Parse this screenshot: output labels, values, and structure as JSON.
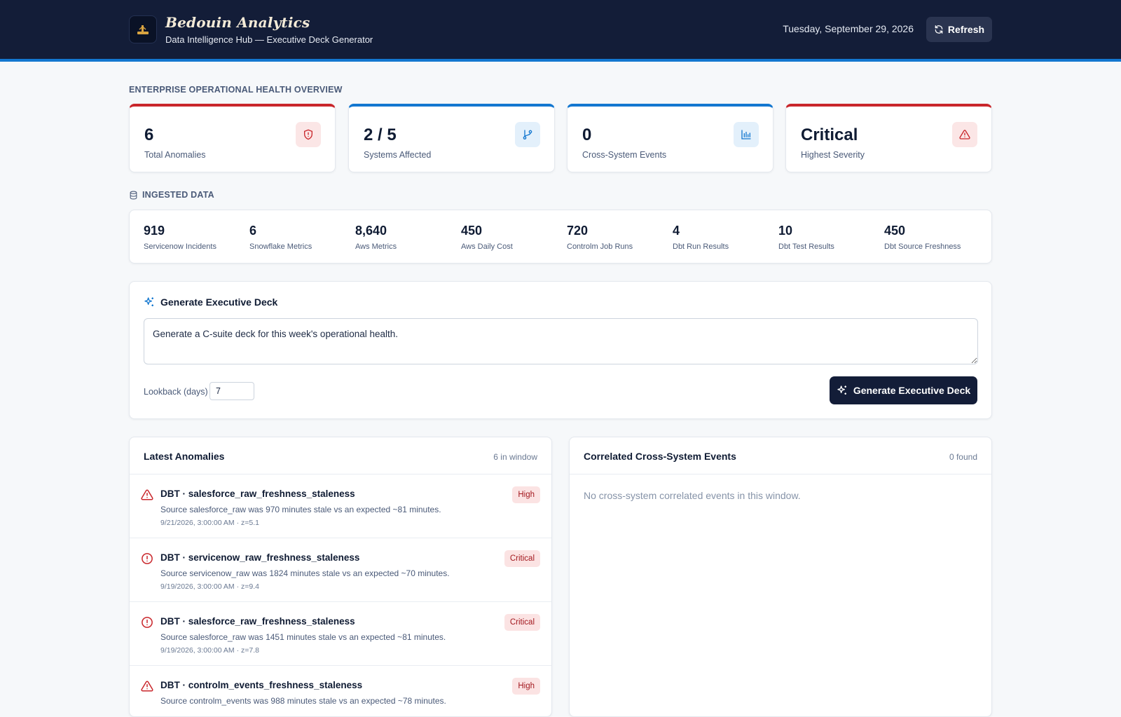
{
  "header": {
    "brand": "Bedouin Analytics",
    "subtitle": "Data Intelligence Hub — Executive Deck Generator",
    "date": "Tuesday, September 29, 2026",
    "refresh_label": "Refresh"
  },
  "overview": {
    "label": "ENTERPRISE OPERATIONAL HEALTH OVERVIEW",
    "cards": [
      {
        "value": "6",
        "label": "Total Anomalies",
        "icon": "shield-alert-icon",
        "accent": "#c9262b"
      },
      {
        "value": "2 / 5",
        "label": "Systems Affected",
        "icon": "git-branch-icon",
        "accent": "#1377d0"
      },
      {
        "value": "0",
        "label": "Cross-System Events",
        "icon": "bar-chart-icon",
        "accent": "#1377d0"
      },
      {
        "value": "Critical",
        "label": "Highest Severity",
        "icon": "warning-triangle-icon",
        "accent": "#c9262b"
      }
    ]
  },
  "ingested": {
    "label": "INGESTED DATA",
    "items": [
      {
        "value": "919",
        "label": "Servicenow Incidents"
      },
      {
        "value": "6",
        "label": "Snowflake Metrics"
      },
      {
        "value": "8,640",
        "label": "Aws Metrics"
      },
      {
        "value": "450",
        "label": "Aws Daily Cost"
      },
      {
        "value": "720",
        "label": "Controlm Job Runs"
      },
      {
        "value": "4",
        "label": "Dbt Run Results"
      },
      {
        "value": "10",
        "label": "Dbt Test Results"
      },
      {
        "value": "450",
        "label": "Dbt Source Freshness"
      }
    ]
  },
  "generate": {
    "title": "Generate Executive Deck",
    "prompt_value": "Generate a C-suite deck for this week's operational health.",
    "lookback_label": "Lookback (days)",
    "lookback_value": "7",
    "button_label": "Generate Executive Deck"
  },
  "anomalies": {
    "title": "Latest Anomalies",
    "count": "6 in window",
    "items": [
      {
        "title": "DBT · salesforce_raw_freshness_staleness",
        "desc": "Source salesforce_raw was 970 minutes stale vs an expected ~81 minutes.",
        "meta": "9/21/2026, 3:00:00 AM · z=5.1",
        "severity": "High",
        "icon": "warning-triangle-icon"
      },
      {
        "title": "DBT · servicenow_raw_freshness_staleness",
        "desc": "Source servicenow_raw was 1824 minutes stale vs an expected ~70 minutes.",
        "meta": "9/19/2026, 3:00:00 AM · z=9.4",
        "severity": "Critical",
        "icon": "alert-circle-icon"
      },
      {
        "title": "DBT · salesforce_raw_freshness_staleness",
        "desc": "Source salesforce_raw was 1451 minutes stale vs an expected ~81 minutes.",
        "meta": "9/19/2026, 3:00:00 AM · z=7.8",
        "severity": "Critical",
        "icon": "alert-circle-icon"
      },
      {
        "title": "DBT · controlm_events_freshness_staleness",
        "desc": "Source controlm_events was 988 minutes stale vs an expected ~78 minutes.",
        "meta": "",
        "severity": "High",
        "icon": "warning-triangle-icon"
      }
    ]
  },
  "correlated": {
    "title": "Correlated Cross-System Events",
    "count": "0 found",
    "empty_text": "No cross-system correlated events in this window."
  }
}
